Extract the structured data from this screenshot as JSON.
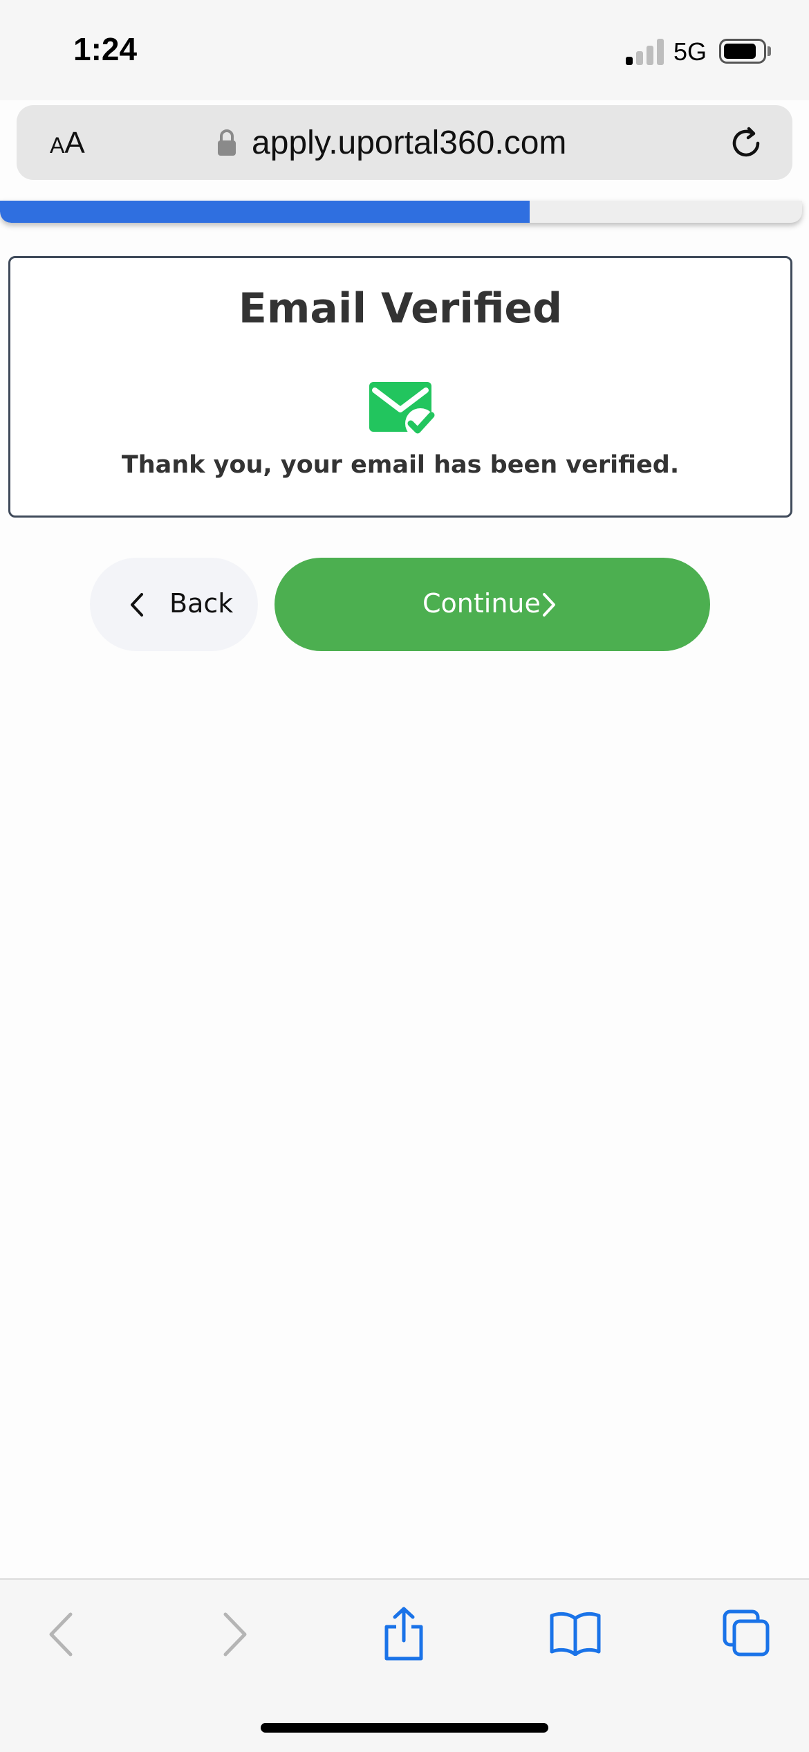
{
  "status_bar": {
    "time": "1:24",
    "network": "5G",
    "signal_bars_active": 1,
    "signal_bars_total": 4,
    "battery_level": 0.8
  },
  "browser": {
    "text_size_small": "A",
    "text_size_large": "A",
    "url": "apply.uportal360.com",
    "lock_icon": "lock-icon",
    "reload_icon": "reload-icon"
  },
  "progress": {
    "value": 0.66,
    "fill_color": "#2f6fe0",
    "track_color": "#eeeeee"
  },
  "card": {
    "title": "Email Verified",
    "icon": "email-verified-icon",
    "icon_color": "#22c55e",
    "message": "Thank you, your email has been verified."
  },
  "actions": {
    "back_label": "Back",
    "continue_label": "Continue",
    "continue_color": "#4caf50"
  },
  "toolbar": {
    "icons": [
      "back-arrow-icon",
      "forward-arrow-icon",
      "share-icon",
      "bookmarks-icon",
      "tabs-icon"
    ],
    "accent_color": "#1a73e8"
  }
}
